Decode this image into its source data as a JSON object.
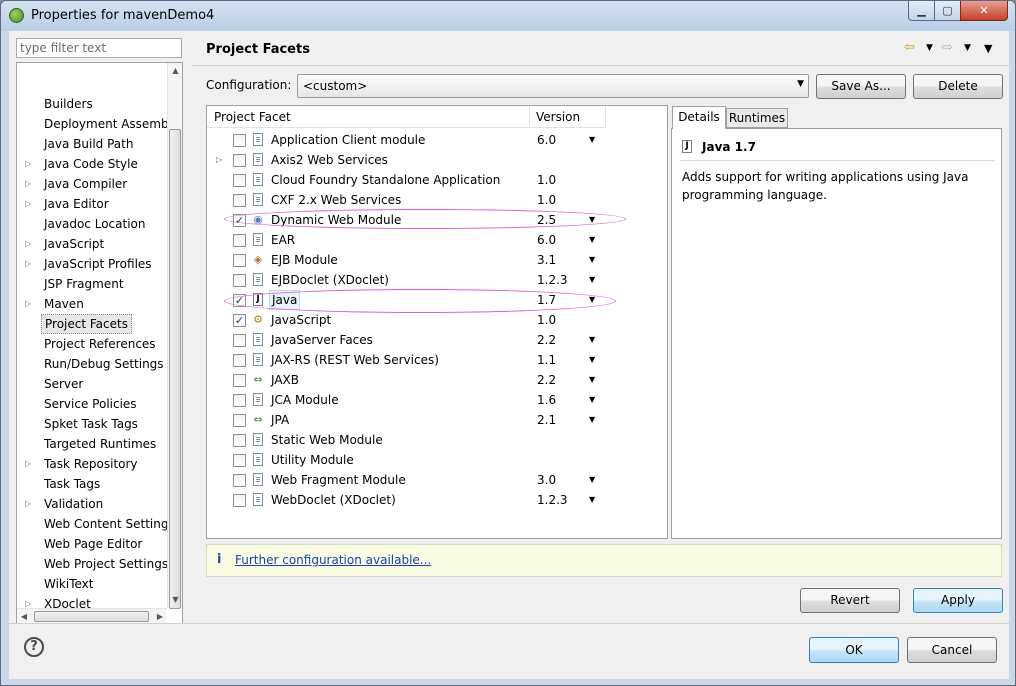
{
  "window": {
    "title": "Properties for mavenDemo4"
  },
  "filter": {
    "placeholder": "type filter text"
  },
  "tree": {
    "items": [
      {
        "label": "Builders",
        "expandable": false,
        "selected": false
      },
      {
        "label": "Deployment Assembly",
        "expandable": false,
        "selected": false
      },
      {
        "label": "Java Build Path",
        "expandable": false,
        "selected": false
      },
      {
        "label": "Java Code Style",
        "expandable": true,
        "selected": false
      },
      {
        "label": "Java Compiler",
        "expandable": true,
        "selected": false
      },
      {
        "label": "Java Editor",
        "expandable": true,
        "selected": false
      },
      {
        "label": "Javadoc Location",
        "expandable": false,
        "selected": false
      },
      {
        "label": "JavaScript",
        "expandable": true,
        "selected": false
      },
      {
        "label": "JavaScript Profiles",
        "expandable": true,
        "selected": false
      },
      {
        "label": "JSP Fragment",
        "expandable": false,
        "selected": false
      },
      {
        "label": "Maven",
        "expandable": true,
        "selected": false
      },
      {
        "label": "Project Facets",
        "expandable": false,
        "selected": true
      },
      {
        "label": "Project References",
        "expandable": false,
        "selected": false
      },
      {
        "label": "Run/Debug Settings",
        "expandable": false,
        "selected": false
      },
      {
        "label": "Server",
        "expandable": false,
        "selected": false
      },
      {
        "label": "Service Policies",
        "expandable": false,
        "selected": false
      },
      {
        "label": "Spket Task Tags",
        "expandable": false,
        "selected": false
      },
      {
        "label": "Targeted Runtimes",
        "expandable": false,
        "selected": false
      },
      {
        "label": "Task Repository",
        "expandable": true,
        "selected": false
      },
      {
        "label": "Task Tags",
        "expandable": false,
        "selected": false
      },
      {
        "label": "Validation",
        "expandable": true,
        "selected": false
      },
      {
        "label": "Web Content Settings",
        "expandable": false,
        "selected": false
      },
      {
        "label": "Web Page Editor",
        "expandable": false,
        "selected": false
      },
      {
        "label": "Web Project Settings",
        "expandable": false,
        "selected": false
      },
      {
        "label": "WikiText",
        "expandable": false,
        "selected": false
      },
      {
        "label": "XDoclet",
        "expandable": true,
        "selected": false
      }
    ]
  },
  "header": {
    "title": "Project Facets"
  },
  "configuration": {
    "label": "Configuration:",
    "value": "<custom>",
    "save_as": "Save As...",
    "delete": "Delete"
  },
  "facets": {
    "col_facet": "Project Facet",
    "col_version": "Version",
    "rows": [
      {
        "name": "Application Client module",
        "version": "6.0",
        "checked": false,
        "dropdown": true,
        "expandable": false,
        "icon": "doc-icon"
      },
      {
        "name": "Axis2 Web Services",
        "version": "",
        "checked": false,
        "dropdown": false,
        "expandable": true,
        "icon": "doc-icon"
      },
      {
        "name": "Cloud Foundry Standalone Application",
        "version": "1.0",
        "checked": false,
        "dropdown": false,
        "expandable": false,
        "icon": "doc-icon"
      },
      {
        "name": "CXF 2.x Web Services",
        "version": "1.0",
        "checked": false,
        "dropdown": false,
        "expandable": false,
        "icon": "doc-icon"
      },
      {
        "name": "Dynamic Web Module",
        "version": "2.5",
        "checked": true,
        "dropdown": true,
        "expandable": false,
        "icon": "web-module-icon"
      },
      {
        "name": "EAR",
        "version": "6.0",
        "checked": false,
        "dropdown": true,
        "expandable": false,
        "icon": "doc-icon"
      },
      {
        "name": "EJB Module",
        "version": "3.1",
        "checked": false,
        "dropdown": true,
        "expandable": false,
        "icon": "ejb-icon"
      },
      {
        "name": "EJBDoclet (XDoclet)",
        "version": "1.2.3",
        "checked": false,
        "dropdown": true,
        "expandable": false,
        "icon": "doc-icon"
      },
      {
        "name": "Java",
        "version": "1.7",
        "checked": true,
        "dropdown": true,
        "expandable": false,
        "icon": "java-icon",
        "selected": true
      },
      {
        "name": "JavaScript",
        "version": "1.0",
        "checked": true,
        "dropdown": false,
        "expandable": false,
        "icon": "javascript-icon"
      },
      {
        "name": "JavaServer Faces",
        "version": "2.2",
        "checked": false,
        "dropdown": true,
        "expandable": false,
        "icon": "doc-icon"
      },
      {
        "name": "JAX-RS (REST Web Services)",
        "version": "1.1",
        "checked": false,
        "dropdown": true,
        "expandable": false,
        "icon": "doc-icon"
      },
      {
        "name": "JAXB",
        "version": "2.2",
        "checked": false,
        "dropdown": true,
        "expandable": false,
        "icon": "jaxb-icon"
      },
      {
        "name": "JCA Module",
        "version": "1.6",
        "checked": false,
        "dropdown": true,
        "expandable": false,
        "icon": "doc-icon"
      },
      {
        "name": "JPA",
        "version": "2.1",
        "checked": false,
        "dropdown": true,
        "expandable": false,
        "icon": "jpa-icon"
      },
      {
        "name": "Static Web Module",
        "version": "",
        "checked": false,
        "dropdown": false,
        "expandable": false,
        "icon": "doc-icon"
      },
      {
        "name": "Utility Module",
        "version": "",
        "checked": false,
        "dropdown": false,
        "expandable": false,
        "icon": "doc-icon"
      },
      {
        "name": "Web Fragment Module",
        "version": "3.0",
        "checked": false,
        "dropdown": true,
        "expandable": false,
        "icon": "doc-icon"
      },
      {
        "name": "WebDoclet (XDoclet)",
        "version": "1.2.3",
        "checked": false,
        "dropdown": true,
        "expandable": false,
        "icon": "doc-icon"
      }
    ]
  },
  "details": {
    "tab_details": "Details",
    "tab_runtimes": "Runtimes",
    "title": "Java 1.7",
    "description": "Adds support for writing applications using Java programming language."
  },
  "info": {
    "link": "Further configuration available..."
  },
  "buttons": {
    "revert": "Revert",
    "apply": "Apply",
    "ok": "OK",
    "cancel": "Cancel"
  },
  "icons": {
    "help": "?",
    "info": "i",
    "java_glyph": "J"
  },
  "colors": {
    "highlight": "#d85fd6",
    "link": "#1a3fae"
  }
}
